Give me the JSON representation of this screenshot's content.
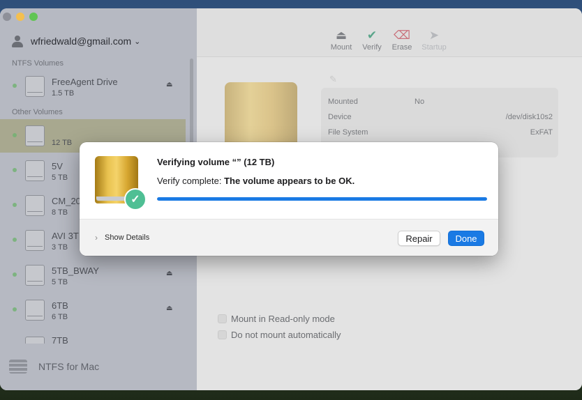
{
  "window": {
    "traffic_lights": [
      "#ec6a5e",
      "#f4bf4f",
      "#61c554"
    ]
  },
  "sidebar": {
    "account": {
      "email": "wfriedwald@gmail.com",
      "chevron": "⌄"
    },
    "sections": {
      "ntfs": "NTFS Volumes",
      "other": "Other Volumes"
    },
    "volumes": [
      {
        "name": "FreeAgent Drive",
        "size": "1.5 TB",
        "eject": "⏏"
      },
      {
        "name": "",
        "size": "12 TB",
        "eject": ""
      },
      {
        "name": "5V",
        "size": "5 TB",
        "eject": ""
      },
      {
        "name": "CM_20",
        "size": "8 TB",
        "eject": ""
      },
      {
        "name": "AVI 3T",
        "size": "3 TB",
        "eject": ""
      },
      {
        "name": "5TB_BWAY",
        "size": "5 TB",
        "eject": "⏏"
      },
      {
        "name": "6TB",
        "size": "6 TB",
        "eject": "⏏"
      },
      {
        "name": "7TB",
        "size": "",
        "eject": ""
      }
    ],
    "app_name": "NTFS for Mac"
  },
  "toolbar": {
    "mount": "Mount",
    "verify": "Verify",
    "erase": "Erase",
    "startup": "Startup"
  },
  "info": {
    "rows": [
      {
        "label": "Mounted",
        "value": "No"
      },
      {
        "label": "Device",
        "value": "/dev/disk10s2"
      },
      {
        "label": "File System",
        "value": "ExFAT"
      }
    ]
  },
  "options": {
    "readonly": "Mount in Read-only mode",
    "no_automount": "Do not mount automatically"
  },
  "dialog": {
    "title": "Verifying volume “” (12 TB)",
    "message_prefix": "Verify complete: ",
    "message_bold": "The volume  appears to be OK.",
    "progress_fraction": 1.0,
    "show_details": "Show Details",
    "repair_label": "Repair",
    "done_label": "Done"
  },
  "colors": {
    "accent": "#1a7ae4",
    "success": "#4fbf94"
  }
}
